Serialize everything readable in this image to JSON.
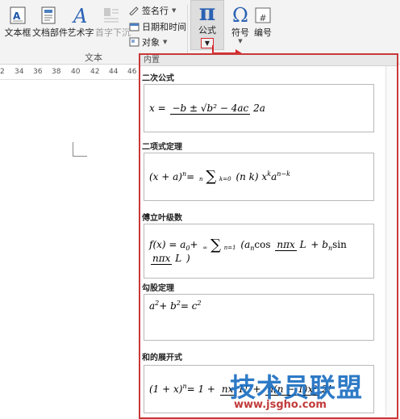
{
  "ribbon": {
    "buttons": {
      "textbox": "文本框",
      "doc_parts": "文档部件",
      "wordart": "艺术字",
      "dropcap": "首字下沉",
      "equation": "公式",
      "symbol": "符号",
      "number": "编号"
    },
    "small_items": {
      "signature": "签名行",
      "datetime": "日期和时间",
      "object": "对象"
    },
    "group_text": "文本",
    "symbol_glyph": "Ω",
    "pi_glyph": "π",
    "number_glyph": "#",
    "highlight_color": "#d7262a"
  },
  "ruler": {
    "ticks": [
      "2",
      "34",
      "36",
      "38",
      "40",
      "42",
      "44",
      "46"
    ]
  },
  "gallery": {
    "header": "内置",
    "sections": [
      {
        "title": "二次公式"
      },
      {
        "title": "二项式定理"
      },
      {
        "title": "傅立叶级数"
      },
      {
        "title": "勾股定理"
      },
      {
        "title": "和的展开式"
      }
    ],
    "equations": {
      "quadratic": {
        "lhs": "x =",
        "num": "−b ± √b² − 4ac",
        "den": "2a"
      },
      "binomial": {
        "lhs": "(x + a)",
        "exp": "n",
        "eq": " = ",
        "sum_top": "n",
        "sum_bottom": "k=0",
        "binom": "(n k)",
        "term": "x",
        "term_exp": "k",
        "term2": "a",
        "term2_exp": "n−k"
      },
      "fourier": {
        "lhs": "f(x) = a",
        "sub0": "0",
        "plus": " + ",
        "sum_top": "∞",
        "sum_bottom": "n=1",
        "body1": "(a",
        "sub_n1": "n",
        "cos": " cos",
        "f1_num": "nπx",
        "f1_den": "L",
        "mid": " + b",
        "sub_n2": "n",
        "sin": " sin",
        "f2_num": "nπx",
        "f2_den": "L",
        "close": ")"
      },
      "pythagorean": {
        "a": "a",
        "b": " + b",
        "c": " = c",
        "exp": "2"
      },
      "sum_expansion": {
        "lhs": "(1 + x)",
        "exp": "n",
        "rhs": " = 1 +",
        "f1_num": "nx",
        "f1_den": "1!",
        "f2_num": "n(n − 1)x²",
        "f2_den": "2!"
      }
    }
  },
  "watermark": {
    "text": "技术员联盟",
    "url": "www.jsgho.com",
    "color_main": "#1c6fc2",
    "color_url": "#c23b3b"
  }
}
